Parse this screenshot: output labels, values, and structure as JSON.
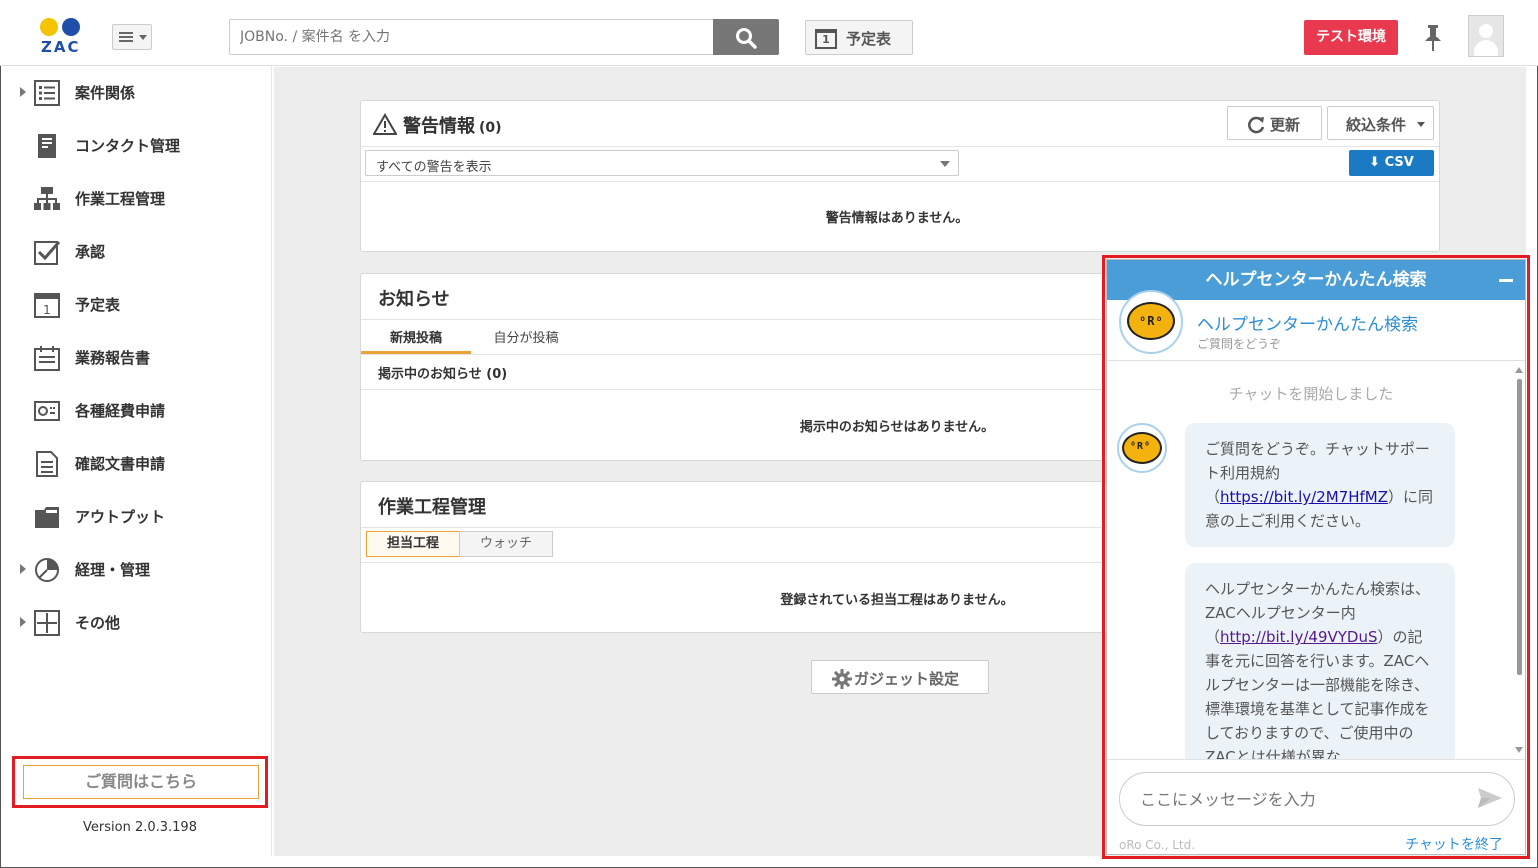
{
  "header": {
    "logo_text": "ZAC",
    "search_placeholder": "JOBNo. / 案件名 を入力",
    "schedule_label": "予定表",
    "schedule_icon_num": "1",
    "env_badge": "テスト環境"
  },
  "sidebar": {
    "items": [
      {
        "label": "案件関係",
        "icon": "list-icon",
        "expandable": true
      },
      {
        "label": "コンタクト管理",
        "icon": "contact-icon",
        "expandable": false
      },
      {
        "label": "作業工程管理",
        "icon": "hierarchy-icon",
        "expandable": false
      },
      {
        "label": "承認",
        "icon": "checkbox-icon",
        "expandable": false
      },
      {
        "label": "予定表",
        "icon": "calendar-icon",
        "expandable": false
      },
      {
        "label": "業務報告書",
        "icon": "report-icon",
        "expandable": false
      },
      {
        "label": "各種経費申請",
        "icon": "expense-icon",
        "expandable": false
      },
      {
        "label": "確認文書申請",
        "icon": "document-icon",
        "expandable": false
      },
      {
        "label": "アウトプット",
        "icon": "folder-icon",
        "expandable": false
      },
      {
        "label": "経理・管理",
        "icon": "pie-chart-icon",
        "expandable": true
      },
      {
        "label": "その他",
        "icon": "plus-box-icon",
        "expandable": true
      }
    ],
    "question_button": "ご質問はこちら",
    "version": "Version 2.0.3.198"
  },
  "alerts": {
    "title": "警告情報",
    "count": "(0)",
    "refresh": "更新",
    "filter": "絞込条件",
    "select_value": "すべての警告を表示",
    "csv": "CSV",
    "empty": "警告情報はありません。"
  },
  "notices": {
    "title": "お知らせ",
    "tabs": [
      "新規投稿",
      "自分が投稿"
    ],
    "active_tab": "新規投稿",
    "subheader": "掲示中のお知らせ",
    "sub_count": "(0)",
    "empty": "掲示中のお知らせはありません。"
  },
  "workflow": {
    "title": "作業工程管理",
    "tabs": [
      "担当工程",
      "ウォッチ"
    ],
    "active_tab": "担当工程",
    "empty": "登録されている担当工程はありません。"
  },
  "gadget_button": "ガジェット設定",
  "chat": {
    "header": "ヘルプセンターかんたん検索",
    "bot_name": "ヘルプセンターかんたん検索",
    "bot_subtitle": "ご質問をどうぞ",
    "bot_face": "ᴼRᴼ",
    "system_message": "チャットを開始しました",
    "msg1_before": "ご質問をどうぞ。チャットサポート利用規約（",
    "msg1_link": "https://bit.ly/2M7HfMZ",
    "msg1_after": "）に同意の上ご利用ください。",
    "msg2_before": "ヘルプセンターかんたん検索は、ZACヘルプセンター内（",
    "msg2_link": "http://bit.ly/49VYDuS",
    "msg2_after": "）の記事を元に回答を行います。ZACヘルプセンターは一部機能を除き、標準環境を基準として記事作成をしておりますので、ご使用中のZACとは仕様が異な",
    "input_placeholder": "ここにメッセージを入力",
    "credit": "oRo Co., Ltd.",
    "end_chat": "チャットを終了"
  },
  "colors": {
    "accent_blue": "#4a9dd6",
    "badge_red": "#e8394f",
    "highlight_red": "#e31b23",
    "tab_orange": "#e8a23a",
    "csv_blue": "#1a7bc4"
  }
}
